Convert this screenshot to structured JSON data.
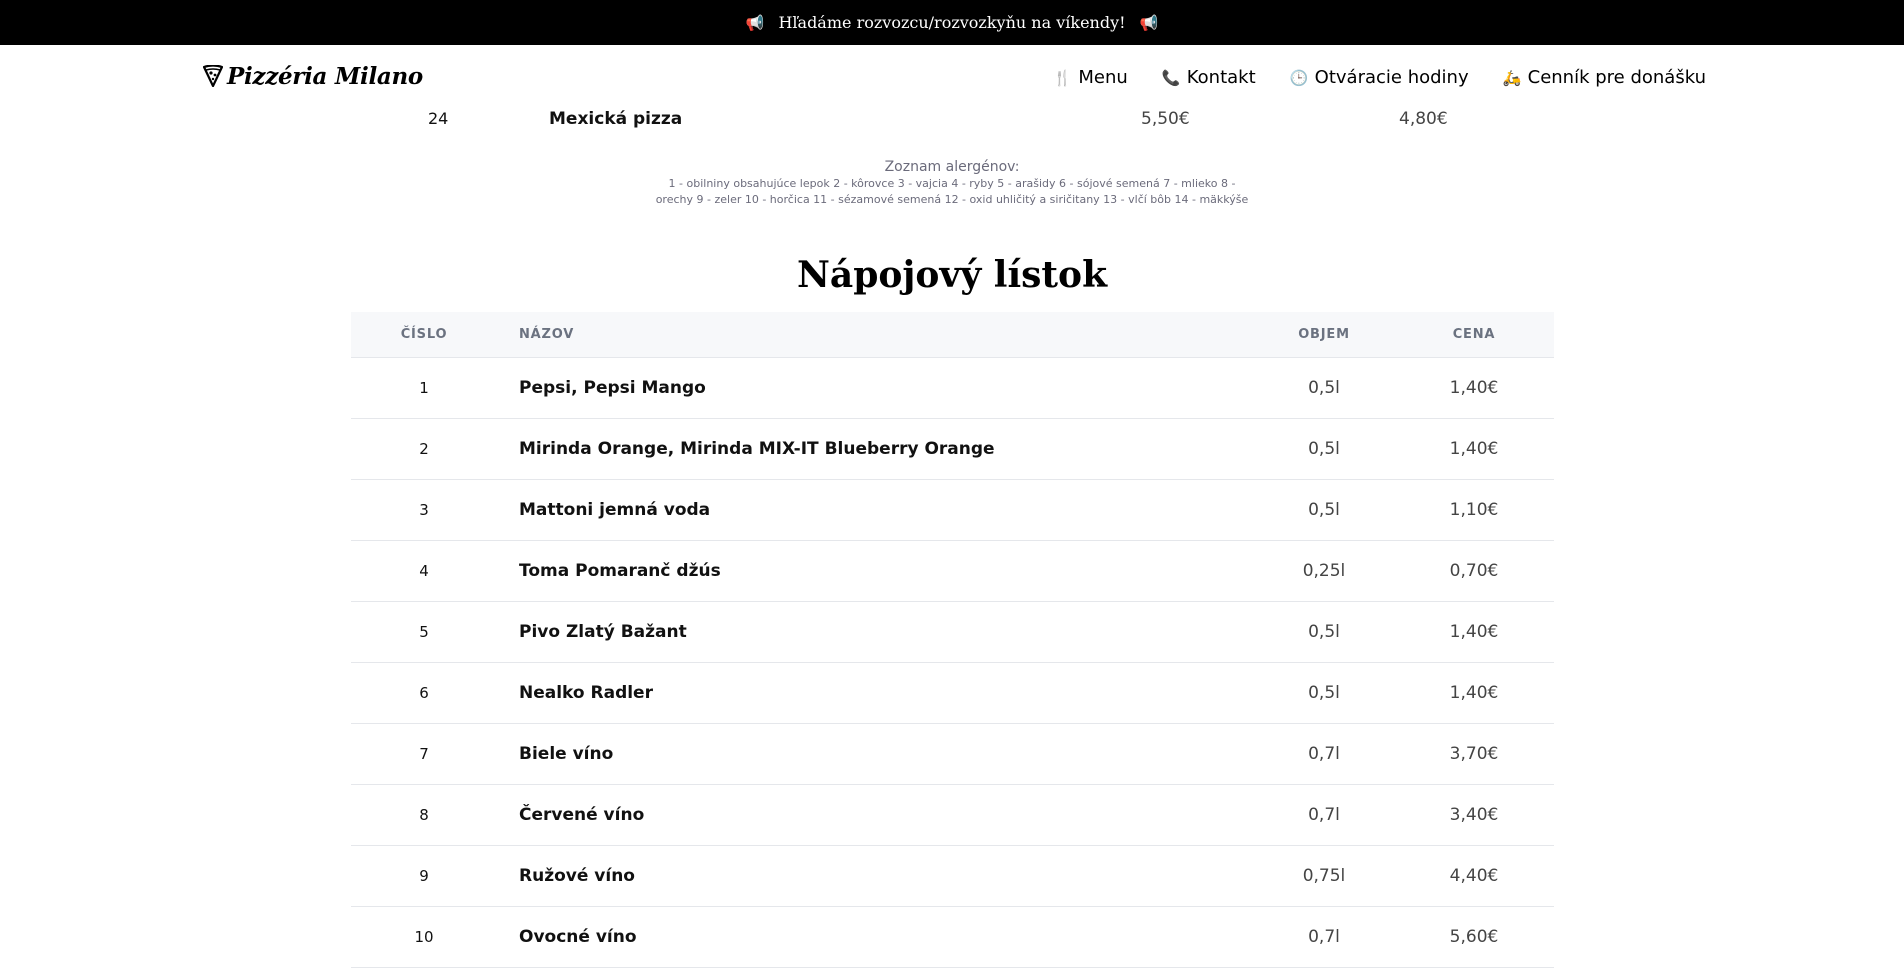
{
  "announcement": {
    "text": "Hľadáme rozvozcu/rozvozkyňu na víkendy!",
    "icon_left": "megaphone-icon",
    "icon_right": "megaphone-icon"
  },
  "header": {
    "logo_text": "Pizzéria Milano",
    "logo_icon": "pizza-slice-icon",
    "nav": [
      {
        "label": "Menu",
        "icon": "fork-knife-icon"
      },
      {
        "label": "Kontakt",
        "icon": "phone-icon"
      },
      {
        "label": "Otváracie hodiny",
        "icon": "clock-icon"
      },
      {
        "label": "Cenník pre donášku",
        "icon": "scooter-icon"
      }
    ]
  },
  "pizza_menu_last_row": {
    "number": "24",
    "name": "Mexická pizza",
    "price_1": "5,50€",
    "price_2": "4,80€"
  },
  "allergens": {
    "heading": "Zoznam alergénov:",
    "line1": "1 - obilniny obsahujúce lepok 2 - kôrovce 3 - vajcia 4 - ryby 5 - arašidy 6 - sójové semená 7 - mlieko 8 -",
    "line2": "orechy 9 - zeler 10 - horčica 11 - sézamové semená 12 - oxid uhličitý a siričitany 13 - vlčí bôb 14 - mäkkýše"
  },
  "drinks": {
    "title": "Nápojový lístok",
    "columns": {
      "number": "ČÍSLO",
      "name": "NÁZOV",
      "volume": "OBJEM",
      "price": "CENA"
    },
    "rows": [
      {
        "number": "1",
        "name": "Pepsi, Pepsi Mango",
        "volume": "0,5l",
        "price": "1,40€"
      },
      {
        "number": "2",
        "name": "Mirinda Orange, Mirinda MIX-IT Blueberry Orange",
        "volume": "0,5l",
        "price": "1,40€"
      },
      {
        "number": "3",
        "name": "Mattoni jemná voda",
        "volume": "0,5l",
        "price": "1,10€"
      },
      {
        "number": "4",
        "name": "Toma Pomaranč džús",
        "volume": "0,25l",
        "price": "0,70€"
      },
      {
        "number": "5",
        "name": "Pivo Zlatý Bažant",
        "volume": "0,5l",
        "price": "1,40€"
      },
      {
        "number": "6",
        "name": "Nealko Radler",
        "volume": "0,5l",
        "price": "1,40€"
      },
      {
        "number": "7",
        "name": "Biele víno",
        "volume": "0,7l",
        "price": "3,70€"
      },
      {
        "number": "8",
        "name": "Červené víno",
        "volume": "0,7l",
        "price": "3,40€"
      },
      {
        "number": "9",
        "name": "Ružové víno",
        "volume": "0,75l",
        "price": "4,40€"
      },
      {
        "number": "10",
        "name": "Ovocné víno",
        "volume": "0,7l",
        "price": "5,60€"
      }
    ]
  }
}
